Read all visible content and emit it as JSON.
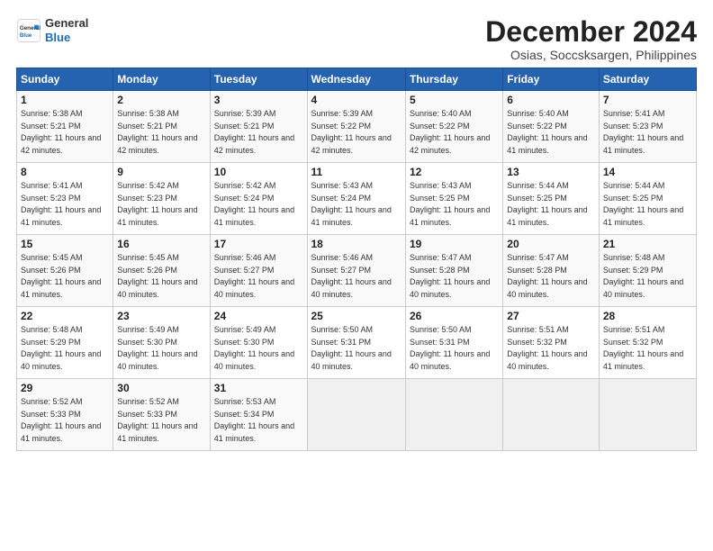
{
  "logo": {
    "line1": "General",
    "line2": "Blue"
  },
  "title": "December 2024",
  "subtitle": "Osias, Soccsksargen, Philippines",
  "days_of_week": [
    "Sunday",
    "Monday",
    "Tuesday",
    "Wednesday",
    "Thursday",
    "Friday",
    "Saturday"
  ],
  "weeks": [
    [
      {
        "day": "1",
        "sunrise": "5:38 AM",
        "sunset": "5:21 PM",
        "daylight": "11 hours and 42 minutes."
      },
      {
        "day": "2",
        "sunrise": "5:38 AM",
        "sunset": "5:21 PM",
        "daylight": "11 hours and 42 minutes."
      },
      {
        "day": "3",
        "sunrise": "5:39 AM",
        "sunset": "5:21 PM",
        "daylight": "11 hours and 42 minutes."
      },
      {
        "day": "4",
        "sunrise": "5:39 AM",
        "sunset": "5:22 PM",
        "daylight": "11 hours and 42 minutes."
      },
      {
        "day": "5",
        "sunrise": "5:40 AM",
        "sunset": "5:22 PM",
        "daylight": "11 hours and 42 minutes."
      },
      {
        "day": "6",
        "sunrise": "5:40 AM",
        "sunset": "5:22 PM",
        "daylight": "11 hours and 41 minutes."
      },
      {
        "day": "7",
        "sunrise": "5:41 AM",
        "sunset": "5:23 PM",
        "daylight": "11 hours and 41 minutes."
      }
    ],
    [
      {
        "day": "8",
        "sunrise": "5:41 AM",
        "sunset": "5:23 PM",
        "daylight": "11 hours and 41 minutes."
      },
      {
        "day": "9",
        "sunrise": "5:42 AM",
        "sunset": "5:23 PM",
        "daylight": "11 hours and 41 minutes."
      },
      {
        "day": "10",
        "sunrise": "5:42 AM",
        "sunset": "5:24 PM",
        "daylight": "11 hours and 41 minutes."
      },
      {
        "day": "11",
        "sunrise": "5:43 AM",
        "sunset": "5:24 PM",
        "daylight": "11 hours and 41 minutes."
      },
      {
        "day": "12",
        "sunrise": "5:43 AM",
        "sunset": "5:25 PM",
        "daylight": "11 hours and 41 minutes."
      },
      {
        "day": "13",
        "sunrise": "5:44 AM",
        "sunset": "5:25 PM",
        "daylight": "11 hours and 41 minutes."
      },
      {
        "day": "14",
        "sunrise": "5:44 AM",
        "sunset": "5:25 PM",
        "daylight": "11 hours and 41 minutes."
      }
    ],
    [
      {
        "day": "15",
        "sunrise": "5:45 AM",
        "sunset": "5:26 PM",
        "daylight": "11 hours and 41 minutes."
      },
      {
        "day": "16",
        "sunrise": "5:45 AM",
        "sunset": "5:26 PM",
        "daylight": "11 hours and 40 minutes."
      },
      {
        "day": "17",
        "sunrise": "5:46 AM",
        "sunset": "5:27 PM",
        "daylight": "11 hours and 40 minutes."
      },
      {
        "day": "18",
        "sunrise": "5:46 AM",
        "sunset": "5:27 PM",
        "daylight": "11 hours and 40 minutes."
      },
      {
        "day": "19",
        "sunrise": "5:47 AM",
        "sunset": "5:28 PM",
        "daylight": "11 hours and 40 minutes."
      },
      {
        "day": "20",
        "sunrise": "5:47 AM",
        "sunset": "5:28 PM",
        "daylight": "11 hours and 40 minutes."
      },
      {
        "day": "21",
        "sunrise": "5:48 AM",
        "sunset": "5:29 PM",
        "daylight": "11 hours and 40 minutes."
      }
    ],
    [
      {
        "day": "22",
        "sunrise": "5:48 AM",
        "sunset": "5:29 PM",
        "daylight": "11 hours and 40 minutes."
      },
      {
        "day": "23",
        "sunrise": "5:49 AM",
        "sunset": "5:30 PM",
        "daylight": "11 hours and 40 minutes."
      },
      {
        "day": "24",
        "sunrise": "5:49 AM",
        "sunset": "5:30 PM",
        "daylight": "11 hours and 40 minutes."
      },
      {
        "day": "25",
        "sunrise": "5:50 AM",
        "sunset": "5:31 PM",
        "daylight": "11 hours and 40 minutes."
      },
      {
        "day": "26",
        "sunrise": "5:50 AM",
        "sunset": "5:31 PM",
        "daylight": "11 hours and 40 minutes."
      },
      {
        "day": "27",
        "sunrise": "5:51 AM",
        "sunset": "5:32 PM",
        "daylight": "11 hours and 40 minutes."
      },
      {
        "day": "28",
        "sunrise": "5:51 AM",
        "sunset": "5:32 PM",
        "daylight": "11 hours and 41 minutes."
      }
    ],
    [
      {
        "day": "29",
        "sunrise": "5:52 AM",
        "sunset": "5:33 PM",
        "daylight": "11 hours and 41 minutes."
      },
      {
        "day": "30",
        "sunrise": "5:52 AM",
        "sunset": "5:33 PM",
        "daylight": "11 hours and 41 minutes."
      },
      {
        "day": "31",
        "sunrise": "5:53 AM",
        "sunset": "5:34 PM",
        "daylight": "11 hours and 41 minutes."
      },
      null,
      null,
      null,
      null
    ]
  ]
}
